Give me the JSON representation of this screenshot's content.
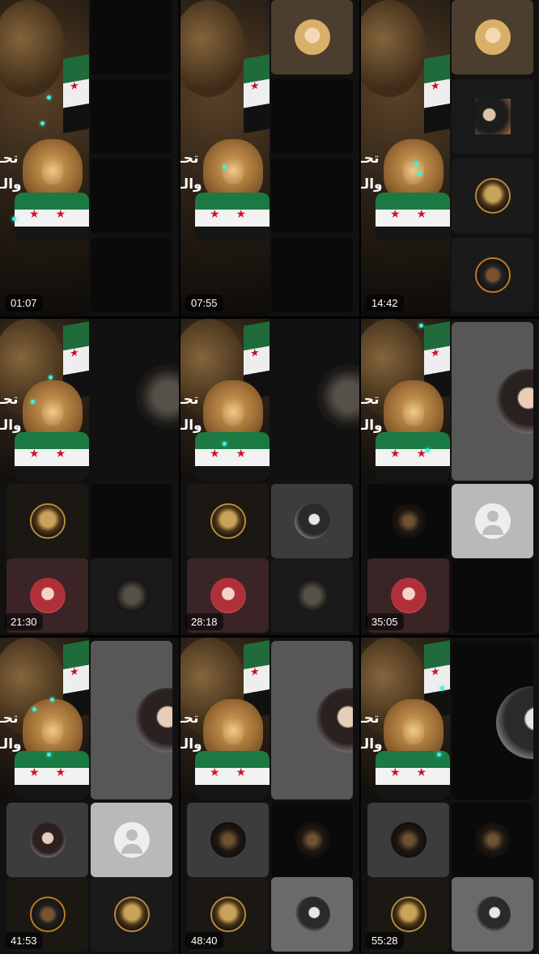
{
  "thumbnails": [
    {
      "duration": "01:07"
    },
    {
      "duration": "07:55"
    },
    {
      "duration": "14:42"
    },
    {
      "duration": "21:30"
    },
    {
      "duration": "28:18"
    },
    {
      "duration": "35:05"
    },
    {
      "duration": "41:53"
    },
    {
      "duration": "48:40"
    },
    {
      "duration": "55:28"
    }
  ],
  "poster_text": {
    "line1": "تحـ",
    "line2": "والـ"
  },
  "colors": {
    "accent_glow": "#3ff3e0",
    "flag_green": "#1f6b3b",
    "flag_star": "#c8102e",
    "background": "#000000"
  }
}
